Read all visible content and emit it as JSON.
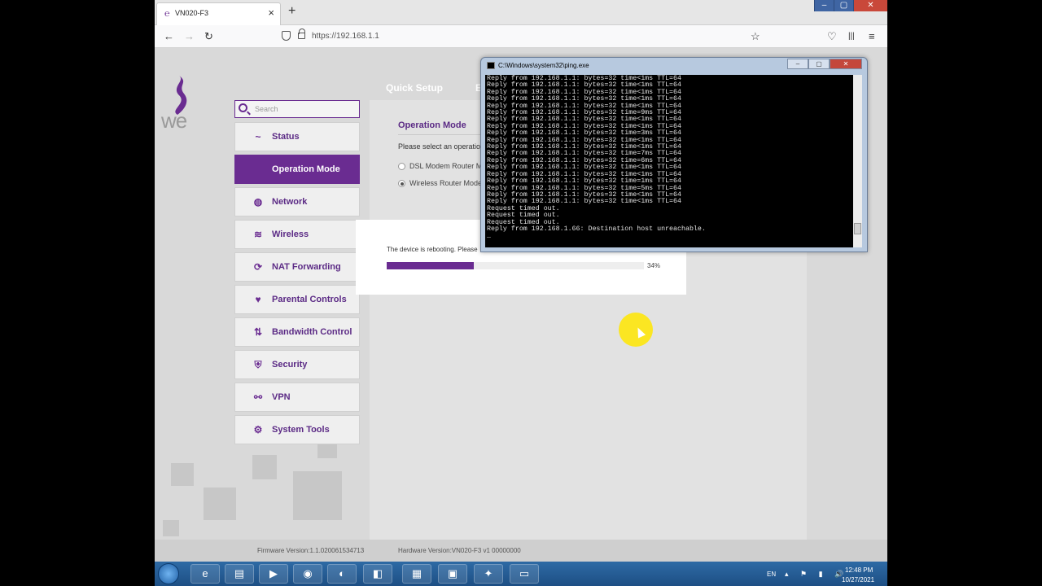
{
  "browser": {
    "tab_title": "VN020-F3",
    "tab_close": "×",
    "new_tab": "+",
    "url": "https://192.168.1.1",
    "back": "←",
    "forward": "→",
    "reload": "↻",
    "bookmark": "☆",
    "pocket": "♡",
    "library": "|||",
    "menu": "≡",
    "min": "–",
    "max": "▢",
    "close": "✕"
  },
  "router": {
    "logo_text": "we",
    "top_nav": [
      "Quick Setup",
      "E"
    ],
    "search_placeholder": "Search",
    "menu": [
      {
        "label": "Status",
        "icon": "~"
      },
      {
        "label": "Operation Mode",
        "icon": ""
      },
      {
        "label": "Network",
        "icon": "◍"
      },
      {
        "label": "Wireless",
        "icon": "≋"
      },
      {
        "label": "NAT Forwarding",
        "icon": "⟳"
      },
      {
        "label": "Parental Controls",
        "icon": "♥"
      },
      {
        "label": "Bandwidth Control",
        "icon": "⇅"
      },
      {
        "label": "Security",
        "icon": "⛨"
      },
      {
        "label": "VPN",
        "icon": "⚯"
      },
      {
        "label": "System Tools",
        "icon": "⚙"
      }
    ],
    "op_title": "Operation Mode",
    "op_desc": "Please select an operation",
    "radio1": "DSL Modem Router M",
    "radio2": "Wireless Router Mode",
    "reboot_text": "The device is rebooting. Please",
    "reboot_pct": "34%",
    "reboot_value": 0.34,
    "firmware": "Firmware Version:1.1.020061534713",
    "hardware": "Hardware Version:VN020-F3 v1 00000000"
  },
  "cmd": {
    "title": "C:\\Windows\\system32\\ping.exe",
    "min": "–",
    "max": "▢",
    "close": "✕",
    "lines": [
      "Reply from 192.168.1.1: bytes=32 time<1ms TTL=64",
      "Reply from 192.168.1.1: bytes=32 time<1ms TTL=64",
      "Reply from 192.168.1.1: bytes=32 time<1ms TTL=64",
      "Reply from 192.168.1.1: bytes=32 time<1ms TTL=64",
      "Reply from 192.168.1.1: bytes=32 time<1ms TTL=64",
      "Reply from 192.168.1.1: bytes=32 time=9ms TTL=64",
      "Reply from 192.168.1.1: bytes=32 time<1ms TTL=64",
      "Reply from 192.168.1.1: bytes=32 time<1ms TTL=64",
      "Reply from 192.168.1.1: bytes=32 time=3ms TTL=64",
      "Reply from 192.168.1.1: bytes=32 time<1ms TTL=64",
      "Reply from 192.168.1.1: bytes=32 time<1ms TTL=64",
      "Reply from 192.168.1.1: bytes=32 time=7ms TTL=64",
      "Reply from 192.168.1.1: bytes=32 time=6ms TTL=64",
      "Reply from 192.168.1.1: bytes=32 time<1ms TTL=64",
      "Reply from 192.168.1.1: bytes=32 time<1ms TTL=64",
      "Reply from 192.168.1.1: bytes=32 time=1ms TTL=64",
      "Reply from 192.168.1.1: bytes=32 time=5ms TTL=64",
      "Reply from 192.168.1.1: bytes=32 time<1ms TTL=64",
      "Reply from 192.168.1.1: bytes=32 time<1ms TTL=64",
      "Request timed out.",
      "Request timed out.",
      "Request timed out.",
      "Reply from 192.168.1.66: Destination host unreachable.",
      "_"
    ]
  },
  "taskbar": {
    "lang": "EN",
    "tray_icons": "▴ ⚑ ▮ 🔊",
    "time": "12:48 PM",
    "date": "10/27/2021"
  }
}
